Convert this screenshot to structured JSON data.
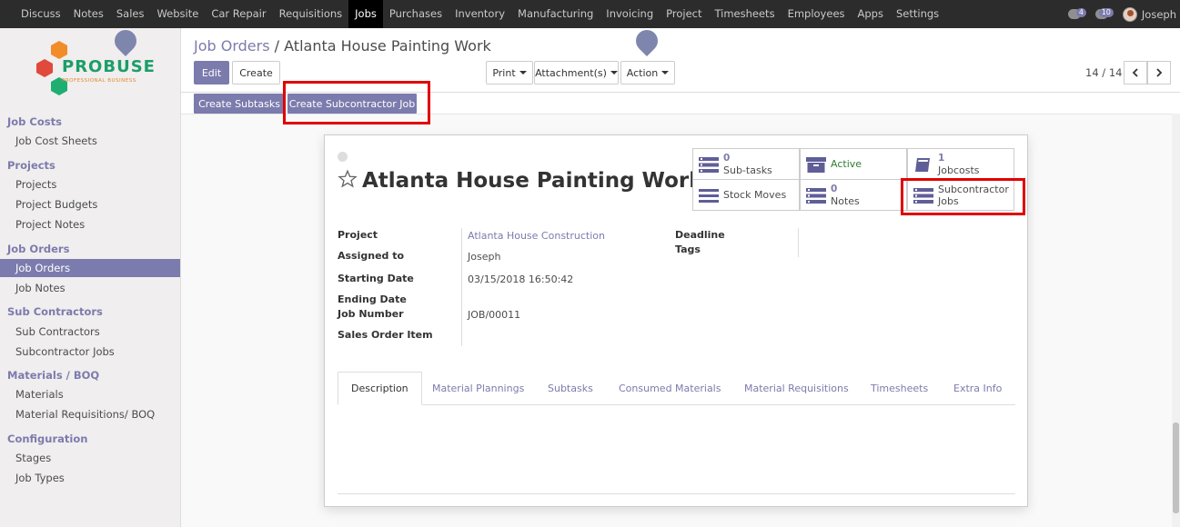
{
  "topnav": {
    "items": [
      "Discuss",
      "Notes",
      "Sales",
      "Website",
      "Car Repair",
      "Requisitions",
      "Jobs",
      "Purchases",
      "Inventory",
      "Manufacturing",
      "Invoicing",
      "Project",
      "Timesheets",
      "Employees",
      "Apps",
      "Settings"
    ],
    "active": "Jobs",
    "activity_count": "4",
    "message_count": "10",
    "user_name": "Joseph"
  },
  "logo": {
    "brand": "PROBUSE",
    "tagline": "PROFESSIONAL BUSINESS"
  },
  "sidebar": {
    "sections": [
      {
        "title": "Job Costs",
        "items": [
          "Job Cost Sheets"
        ]
      },
      {
        "title": "Projects",
        "items": [
          "Projects",
          "Project Budgets",
          "Project Notes"
        ]
      },
      {
        "title": "Job Orders",
        "items": [
          "Job Orders",
          "Job Notes"
        ]
      },
      {
        "title": "Sub Contractors",
        "items": [
          "Sub Contractors",
          "Subcontractor Jobs"
        ]
      },
      {
        "title": "Materials / BOQ",
        "items": [
          "Materials",
          "Material Requisitions/ BOQ"
        ]
      },
      {
        "title": "Configuration",
        "items": [
          "Stages",
          "Job Types"
        ]
      }
    ],
    "active_item": "Job Orders"
  },
  "breadcrumb": {
    "parent": "Job Orders",
    "separator": "/",
    "current": "Atlanta House Painting Work"
  },
  "controls": {
    "edit": "Edit",
    "create": "Create",
    "print": "Print",
    "attachments": "Attachment(s)",
    "action": "Action",
    "pager": "14 / 14"
  },
  "header_buttons": {
    "create_subtasks": "Create Subtasks",
    "create_subcontractor_job": "Create Subcontractor Job"
  },
  "record": {
    "title": "Atlanta House Painting Work",
    "smart_buttons": {
      "subtasks": {
        "count": "0",
        "label": "Sub-tasks"
      },
      "active": {
        "label": "Active"
      },
      "jobcosts": {
        "count": "1",
        "label": "Jobcosts"
      },
      "stock_moves": {
        "label": "Stock Moves"
      },
      "notes": {
        "count": "0",
        "label": "Notes"
      },
      "subcontractor_jobs": {
        "label1": "Subcontractor",
        "label2": "Jobs"
      }
    },
    "fields": {
      "project_label": "Project",
      "project_value": "Atlanta House Construction",
      "assigned_label": "Assigned to",
      "assigned_value": "Joseph",
      "start_label": "Starting Date",
      "start_value": "03/15/2018 16:50:42",
      "end_label": "Ending Date",
      "jobnum_label": "Job Number",
      "jobnum_value": "JOB/00011",
      "soitem_label": "Sales Order Item",
      "deadline_label": "Deadline",
      "tags_label": "Tags"
    },
    "tabs": [
      "Description",
      "Material Plannings",
      "Subtasks",
      "Consumed Materials",
      "Material Requisitions",
      "Timesheets",
      "Extra Info"
    ],
    "active_tab": "Description"
  },
  "colors": {
    "accent": "#7c7bad",
    "highlight": "#e00000",
    "active_green": "#2e7d32"
  }
}
